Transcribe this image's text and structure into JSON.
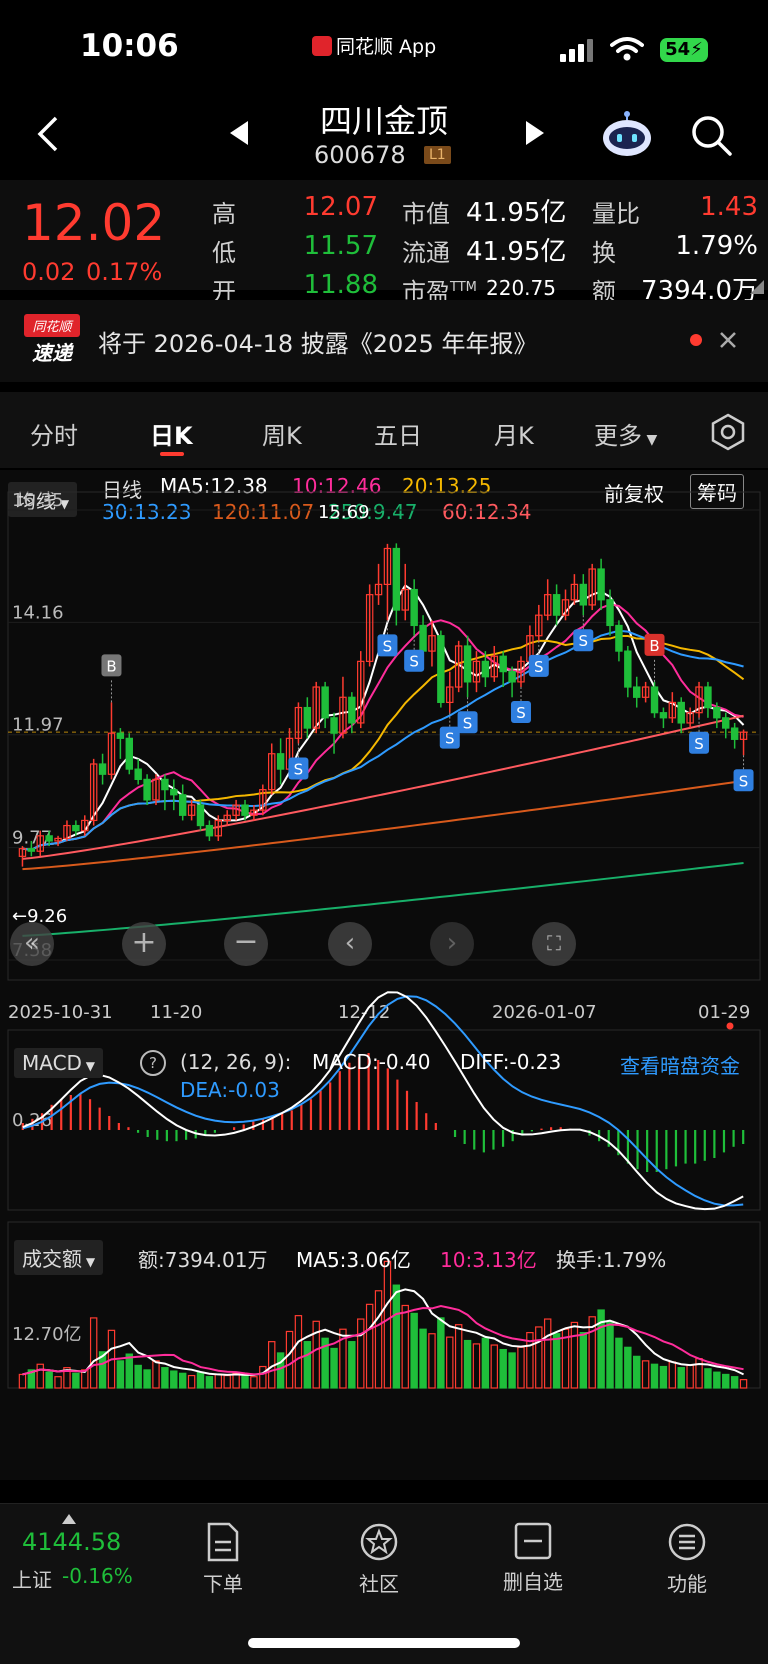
{
  "status_bar": {
    "time": "10:06",
    "app_label": "同花顺 App",
    "battery": "54"
  },
  "header": {
    "name": "四川金顶",
    "code": "600678",
    "level_badge": "L1"
  },
  "quote": {
    "price": "12.02",
    "change": "0.02",
    "change_pct": "0.17%",
    "rows": [
      {
        "l1": "高",
        "v1": "12.07",
        "l2": "市值",
        "v2": "41.95亿",
        "l3": "量比",
        "v3": "1.43"
      },
      {
        "l1": "低",
        "v1": "11.57",
        "l2": "流通",
        "v2": "41.95亿",
        "l3": "换",
        "v3": "1.79%"
      },
      {
        "l1": "开",
        "v1": "11.88",
        "l2": "市盈",
        "l2_sup": "TTM",
        "v2": "220.75",
        "l3": "额",
        "v3": "7394.0万"
      }
    ]
  },
  "notice": {
    "badge_top": "同花顺",
    "badge_bottom": "速递",
    "text": "将于 2026-04-18 披露《2025 年年报》"
  },
  "tabs": {
    "items": [
      "分时",
      "日K",
      "周K",
      "五日",
      "月K",
      "更多"
    ],
    "active": "日K"
  },
  "ma_legend": {
    "selector": "均线",
    "type": "日线",
    "ma5": "MA5:12.38",
    "ma10": "10:12.46",
    "ma20": "20:13.25",
    "ma30": "30:13.23",
    "ma120": "120:11.07",
    "ma250": "250:9.47",
    "ma60": "60:12.34",
    "adjust": "前复权",
    "chips": "筹码"
  },
  "kline_axis": {
    "y_ticks": [
      "16.35",
      "14.16",
      "11.97",
      "9.77",
      "7.58"
    ],
    "x_ticks": [
      "2025-10-31",
      "11-20",
      "12-12",
      "2026-01-07",
      "01-29"
    ],
    "high_label": "15.69",
    "low_label": "9.26"
  },
  "macd": {
    "selector": "MACD",
    "params": "(12, 26, 9):",
    "macd": "MACD:-0.40",
    "diff": "DIFF:-0.23",
    "dea": "DEA:-0.03",
    "link": "查看暗盘资金",
    "y_tick": "0.26"
  },
  "volume": {
    "selector": "成交额",
    "amount": "额:7394.01万",
    "ma5": "MA5:3.06亿",
    "ma10": "10:3.13亿",
    "turnover": "换手:1.79%",
    "y_tick": "12.70亿"
  },
  "bottom_bar": {
    "index_value": "4144.58",
    "index_name": "上证",
    "index_change": "-0.16%",
    "items": [
      "下单",
      "社区",
      "删自选",
      "功能"
    ]
  },
  "colors": {
    "up": "#ff3b30",
    "down": "#1fbe3a",
    "ma5": "#ffffff",
    "ma10": "#ff2d9b",
    "ma20": "#f5b800",
    "ma30": "#2f9bff",
    "ma60": "#ff5a5f",
    "ma120": "#d85a1c",
    "ma250": "#18b06a"
  },
  "chart_data": {
    "type": "candlestick",
    "candles": [
      [
        9.6,
        9.75,
        9.4,
        9.8
      ],
      [
        9.75,
        9.7,
        9.6,
        9.9
      ],
      [
        9.7,
        10.0,
        9.6,
        10.1
      ],
      [
        10.0,
        9.9,
        9.8,
        10.1
      ],
      [
        9.9,
        9.95,
        9.8,
        10.0
      ],
      [
        9.95,
        10.2,
        9.9,
        10.3
      ],
      [
        10.2,
        10.1,
        10.0,
        10.3
      ],
      [
        10.1,
        10.3,
        10.0,
        10.4
      ],
      [
        10.3,
        11.4,
        10.2,
        11.5
      ],
      [
        11.4,
        11.2,
        11.0,
        11.6
      ],
      [
        11.2,
        12.0,
        11.1,
        12.6
      ],
      [
        12.0,
        11.9,
        11.5,
        12.1
      ],
      [
        11.9,
        11.3,
        11.2,
        12.0
      ],
      [
        11.3,
        11.1,
        11.0,
        11.5
      ],
      [
        11.1,
        10.7,
        10.6,
        11.2
      ],
      [
        10.7,
        11.1,
        10.6,
        11.2
      ],
      [
        11.1,
        10.9,
        10.5,
        11.2
      ],
      [
        10.9,
        10.8,
        10.5,
        11.1
      ],
      [
        10.8,
        10.4,
        10.3,
        11.0
      ],
      [
        10.4,
        10.6,
        10.3,
        10.7
      ],
      [
        10.6,
        10.2,
        10.1,
        10.7
      ],
      [
        10.2,
        10.0,
        9.9,
        10.3
      ],
      [
        10.0,
        10.3,
        9.9,
        10.4
      ],
      [
        10.3,
        10.4,
        10.2,
        10.5
      ],
      [
        10.4,
        10.6,
        10.3,
        10.7
      ],
      [
        10.6,
        10.4,
        10.3,
        10.7
      ],
      [
        10.4,
        10.5,
        10.3,
        10.6
      ],
      [
        10.5,
        10.9,
        10.4,
        11.0
      ],
      [
        10.9,
        11.6,
        10.8,
        11.8
      ],
      [
        11.6,
        11.3,
        11.0,
        11.9
      ],
      [
        11.3,
        11.9,
        11.2,
        12.1
      ],
      [
        11.9,
        12.5,
        11.8,
        12.6
      ],
      [
        12.5,
        12.1,
        11.9,
        12.7
      ],
      [
        12.1,
        12.9,
        12.0,
        13.0
      ],
      [
        12.9,
        12.3,
        12.1,
        13.0
      ],
      [
        12.3,
        12.0,
        11.6,
        12.4
      ],
      [
        12.0,
        12.7,
        11.9,
        13.1
      ],
      [
        12.7,
        12.2,
        12.0,
        12.8
      ],
      [
        12.2,
        13.4,
        12.1,
        13.6
      ],
      [
        13.4,
        14.7,
        13.3,
        14.9
      ],
      [
        14.7,
        14.9,
        14.5,
        15.3
      ],
      [
        14.9,
        15.6,
        14.2,
        15.69
      ],
      [
        15.6,
        14.4,
        14.1,
        15.7
      ],
      [
        14.4,
        14.8,
        14.2,
        15.3
      ],
      [
        14.8,
        14.1,
        13.9,
        15.0
      ],
      [
        14.1,
        13.6,
        13.4,
        14.3
      ],
      [
        13.6,
        13.9,
        13.3,
        14.2
      ],
      [
        13.9,
        12.6,
        12.5,
        14.0
      ],
      [
        12.6,
        12.9,
        12.4,
        13.2
      ],
      [
        12.9,
        13.7,
        12.8,
        13.8
      ],
      [
        13.7,
        13.0,
        12.7,
        13.9
      ],
      [
        13.0,
        13.4,
        12.8,
        13.6
      ],
      [
        13.4,
        13.1,
        12.9,
        13.6
      ],
      [
        13.1,
        13.5,
        13.0,
        13.7
      ],
      [
        13.5,
        13.2,
        12.9,
        13.6
      ],
      [
        13.2,
        13.0,
        12.7,
        13.3
      ],
      [
        13.0,
        13.4,
        12.9,
        13.5
      ],
      [
        13.4,
        13.9,
        13.3,
        14.1
      ],
      [
        13.9,
        14.3,
        13.8,
        14.5
      ],
      [
        14.3,
        14.7,
        14.2,
        15.0
      ],
      [
        14.7,
        14.3,
        14.1,
        14.9
      ],
      [
        14.3,
        14.6,
        14.2,
        14.8
      ],
      [
        14.6,
        14.9,
        14.5,
        15.1
      ],
      [
        14.9,
        14.5,
        14.3,
        15.1
      ],
      [
        14.5,
        15.2,
        14.4,
        15.3
      ],
      [
        15.2,
        14.6,
        14.4,
        15.4
      ],
      [
        14.6,
        14.1,
        13.9,
        14.8
      ],
      [
        14.1,
        13.6,
        13.4,
        14.2
      ],
      [
        13.6,
        12.9,
        12.7,
        13.7
      ],
      [
        12.9,
        12.7,
        12.5,
        13.1
      ],
      [
        12.7,
        12.9,
        12.6,
        13.0
      ],
      [
        12.9,
        12.4,
        12.3,
        13.0
      ],
      [
        12.4,
        12.3,
        12.1,
        12.5
      ],
      [
        12.3,
        12.6,
        12.2,
        12.8
      ],
      [
        12.6,
        12.2,
        12.0,
        12.7
      ],
      [
        12.2,
        12.4,
        12.1,
        12.5
      ],
      [
        12.4,
        12.9,
        12.3,
        13.0
      ],
      [
        12.9,
        12.5,
        12.3,
        13.0
      ],
      [
        12.5,
        12.3,
        12.1,
        12.6
      ],
      [
        12.3,
        12.1,
        11.9,
        12.4
      ],
      [
        12.1,
        11.88,
        11.7,
        12.2
      ],
      [
        11.88,
        12.02,
        11.57,
        12.07
      ]
    ],
    "signals": [
      {
        "type": "B",
        "index": 10
      },
      {
        "type": "S",
        "index": 31
      },
      {
        "type": "S",
        "index": 41
      },
      {
        "type": "S",
        "index": 44
      },
      {
        "type": "S",
        "index": 48
      },
      {
        "type": "S",
        "index": 50
      },
      {
        "type": "S",
        "index": 56
      },
      {
        "type": "S",
        "index": 58
      },
      {
        "type": "S",
        "index": 63
      },
      {
        "type": "B",
        "index": 71
      },
      {
        "type": "S",
        "index": 76
      },
      {
        "type": "S",
        "index": 81
      }
    ],
    "macd_hist": [
      0.05,
      0.08,
      0.12,
      0.18,
      0.22,
      0.25,
      0.26,
      0.22,
      0.16,
      0.1,
      0.05,
      0.02,
      -0.02,
      -0.05,
      -0.07,
      -0.08,
      -0.08,
      -0.07,
      -0.06,
      -0.04,
      -0.02,
      0.0,
      0.02,
      0.04,
      0.06,
      0.08,
      0.1,
      0.12,
      0.14,
      0.18,
      0.22,
      0.28,
      0.34,
      0.42,
      0.48,
      0.52,
      0.55,
      0.5,
      0.44,
      0.36,
      0.28,
      0.2,
      0.12,
      0.05,
      0.0,
      -0.05,
      -0.1,
      -0.14,
      -0.16,
      -0.14,
      -0.12,
      -0.08,
      -0.04,
      -0.01,
      0.01,
      0.02,
      0.02,
      0.01,
      0.0,
      -0.04,
      -0.08,
      -0.12,
      -0.18,
      -0.24,
      -0.28,
      -0.3,
      -0.3,
      -0.28,
      -0.26,
      -0.24,
      -0.24,
      -0.22,
      -0.2,
      -0.16,
      -0.12,
      -0.1
    ],
    "volume": [
      1.2,
      1.6,
      2.1,
      1.4,
      1.0,
      1.8,
      1.3,
      1.6,
      6.2,
      3.2,
      5.1,
      2.4,
      3.0,
      2.0,
      1.6,
      2.4,
      1.8,
      1.5,
      1.3,
      1.1,
      1.4,
      1.0,
      1.2,
      1.1,
      1.3,
      1.2,
      1.0,
      1.9,
      4.1,
      3.1,
      5.0,
      6.4,
      4.1,
      5.9,
      4.4,
      3.5,
      5.2,
      4.1,
      6.1,
      7.4,
      8.6,
      11.2,
      9.1,
      7.3,
      6.6,
      5.2,
      4.8,
      6.2,
      4.5,
      5.6,
      4.2,
      3.9,
      4.4,
      3.8,
      3.4,
      3.1,
      3.6,
      4.9,
      5.4,
      6.1,
      4.8,
      5.2,
      5.8,
      4.9,
      6.3,
      6.9,
      5.9,
      4.4,
      3.6,
      2.8,
      2.4,
      2.1,
      1.9,
      2.3,
      1.8,
      2.0,
      2.6,
      1.7,
      1.4,
      1.2,
      1.0,
      0.74
    ]
  }
}
